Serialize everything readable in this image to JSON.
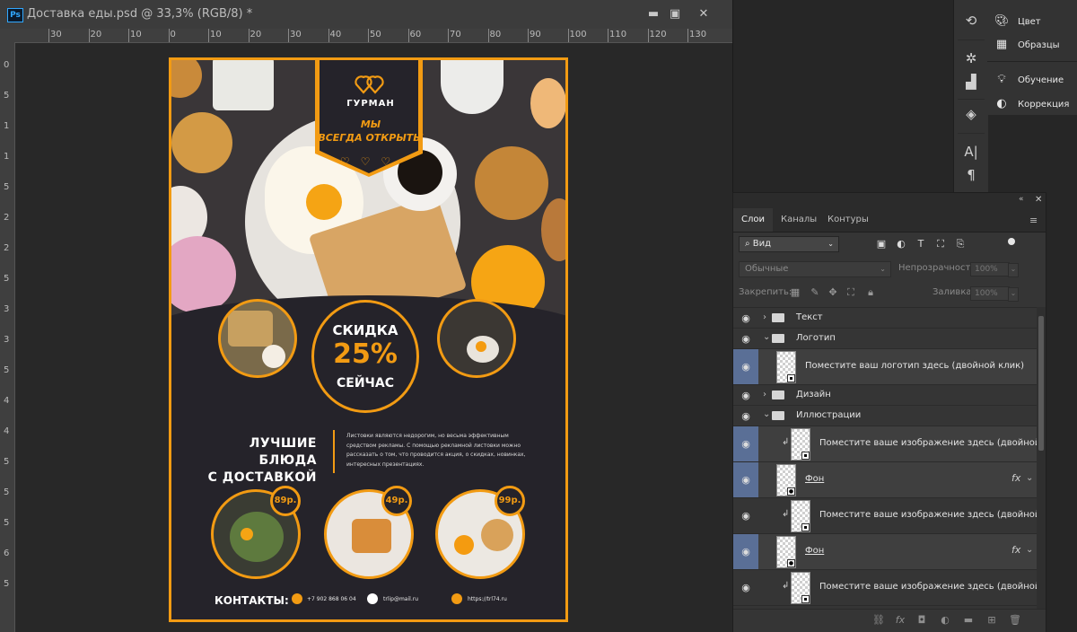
{
  "window": {
    "app_icon": "Ps",
    "title": "Доставка еды.psd @ 33,3% (RGB/8) *",
    "controls": [
      "minimize-icon",
      "restore-icon",
      "close-icon"
    ]
  },
  "ruler_h": [
    "30",
    "20",
    "10",
    "0",
    "10",
    "20",
    "30",
    "40",
    "50",
    "60",
    "70",
    "80",
    "90",
    "100",
    "110",
    "120",
    "130"
  ],
  "ruler_v": [
    "0",
    "5",
    "1",
    "1",
    "5",
    "2",
    "2",
    "5",
    "3",
    "3",
    "5",
    "4",
    "4",
    "5",
    "5",
    "5",
    "6",
    "5"
  ],
  "poster": {
    "brand": "ГУРМАН",
    "open_line1": "МЫ",
    "open_line2": "ВСЕГДА ОТКРЫТЫ",
    "sale_top": "СКИДКА",
    "sale_value": "25%",
    "sale_bottom": "СЕЙЧАС",
    "headline1": "ЛУЧШИЕ БЛЮДА",
    "headline2": "С ДОСТАВКОЙ",
    "description": "Листовки являются недорогим, но весьма эффективным средством рекламы. С помощью рекламной листовки можно рассказать о том, что проводится акция, о скидках, новинках, интересных презентациях.",
    "prices": [
      "89р.",
      "49р.",
      "99р."
    ],
    "contacts_label": "КОНТАКТЫ:",
    "phone": "+7 902 868 06 04",
    "email": "trlip@mail.ru",
    "site": "https://trl74.ru",
    "accent": "#f29b13",
    "background": "#25232a",
    "photo_placeholder_note": "photographic food imagery rendered as colored shapes"
  },
  "tools": [
    "history-icon",
    "ship-wheel-icon",
    "histogram-icon",
    "3d-cube-icon",
    "character-icon",
    "paragraph-icon"
  ],
  "top_panels": [
    {
      "icon": "palette-icon",
      "label": "Цвет"
    },
    {
      "icon": "grid-icon",
      "label": "Образцы"
    },
    {
      "icon": "lightbulb-icon",
      "label": "Обучение"
    },
    {
      "icon": "adjust-icon",
      "label": "Коррекция"
    }
  ],
  "layers_panel": {
    "tabs": [
      "Слои",
      "Каналы",
      "Контуры"
    ],
    "active_tab": "Слои",
    "filter_label": "Вид",
    "blend_mode": "Обычные",
    "opacity_label": "Непрозрачность:",
    "opacity_value": "100%",
    "lock_label": "Закрепить:",
    "fill_label": "Заливка:",
    "fill_value": "100%",
    "layers": [
      {
        "type": "group",
        "name": "Текст",
        "expanded": false,
        "selected": false
      },
      {
        "type": "group",
        "name": "Логотип",
        "expanded": true,
        "selected": false
      },
      {
        "type": "smart",
        "name": "Поместите ваш логотип здесь (двойной клик)",
        "selected": true
      },
      {
        "type": "group",
        "name": "Дизайн",
        "expanded": false,
        "selected": false
      },
      {
        "type": "group",
        "name": "Иллюстрации",
        "expanded": true,
        "selected": false
      },
      {
        "type": "smart",
        "name": "Поместите ваше изображение здесь (двойной к...",
        "clipped": true,
        "selected": true
      },
      {
        "type": "layer",
        "name": "Фон",
        "fx": true,
        "selected": true
      },
      {
        "type": "smart",
        "name": "Поместите ваше изображение здесь (двойной к...",
        "clipped": true,
        "selected": false
      },
      {
        "type": "layer",
        "name": "Фон",
        "fx": true,
        "selected": true
      },
      {
        "type": "smart",
        "name": "Поместите ваше изображение здесь (двойной к...",
        "clipped": true,
        "selected": false
      }
    ],
    "fx_label": "fx"
  }
}
